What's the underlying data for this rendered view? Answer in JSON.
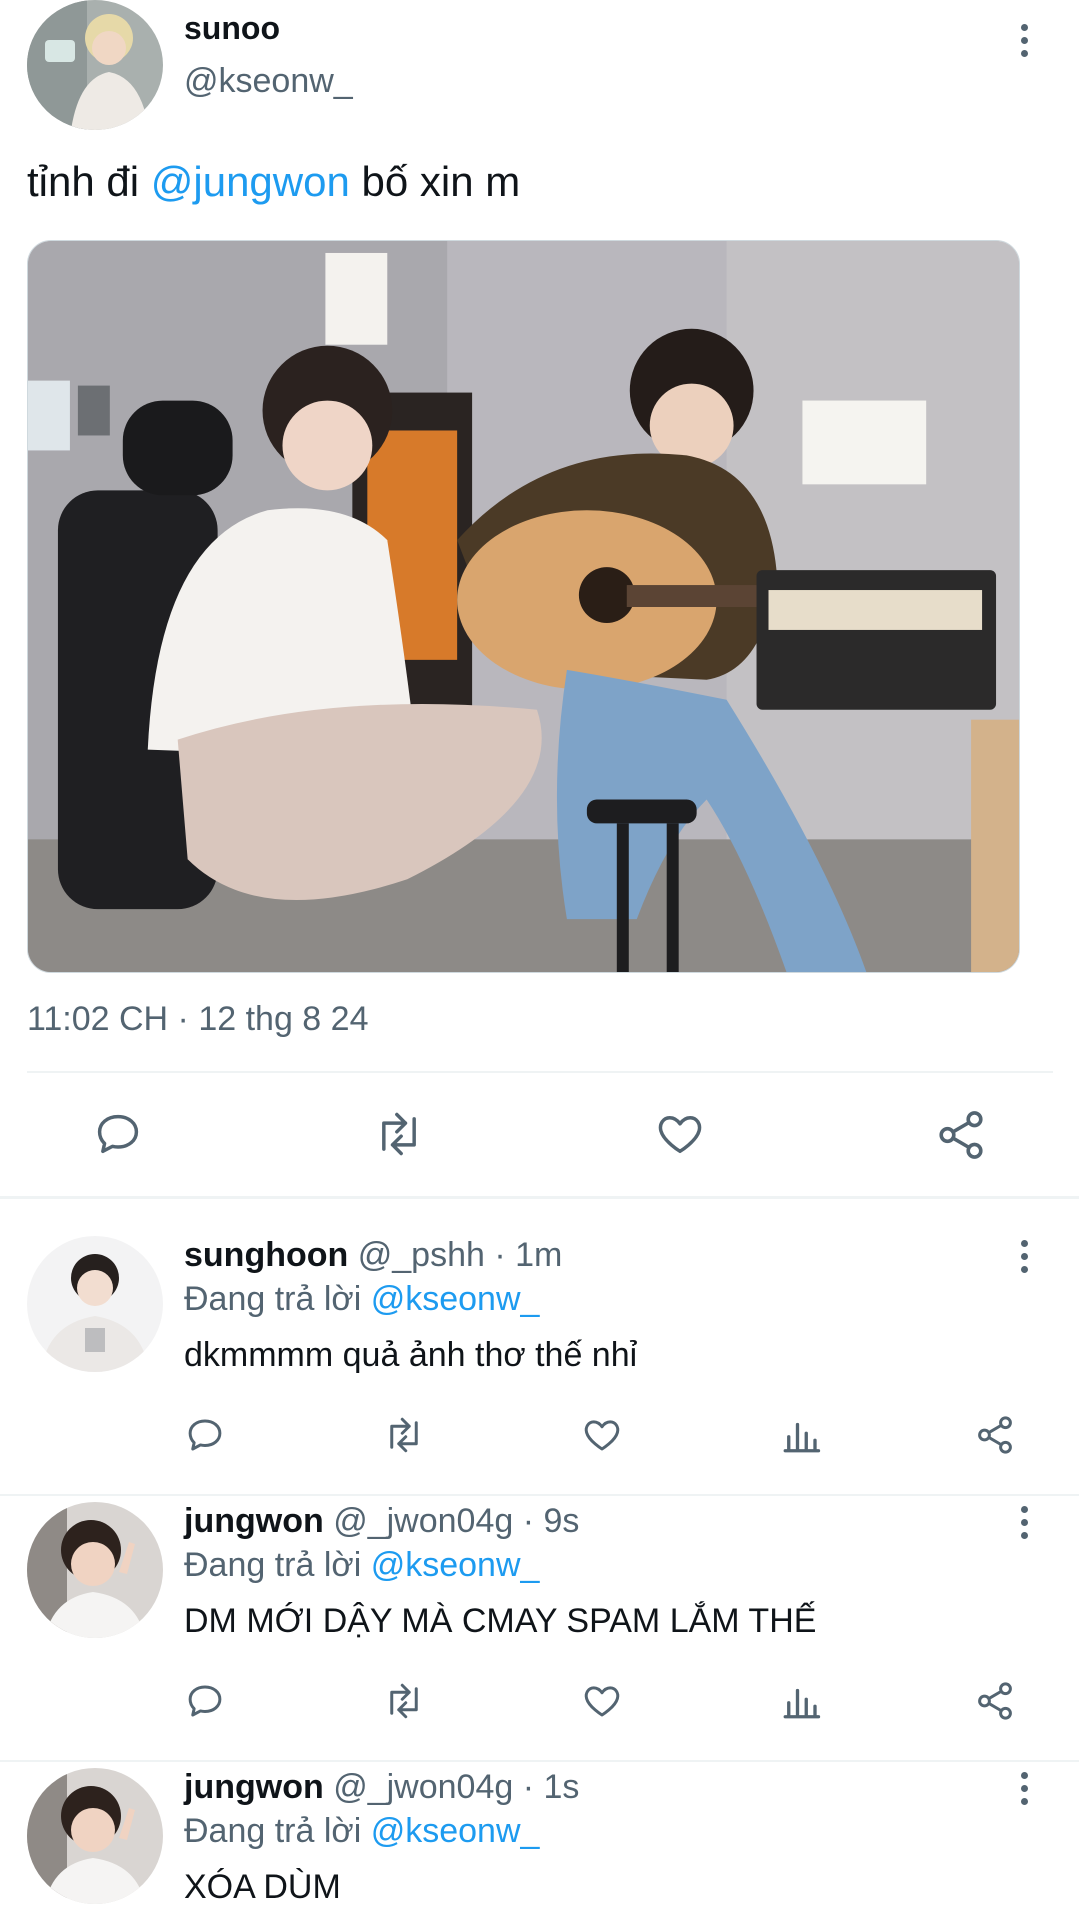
{
  "main_tweet": {
    "display_name": "sunoo",
    "handle": "@kseonw_",
    "text_before": "tỉnh đi ",
    "mention": "@jungwon",
    "text_after": " bố xin m",
    "timestamp": "11:02 CH · 12 thg 8 24",
    "actions": [
      "reply-icon",
      "retweet-icon",
      "like-icon",
      "share-icon"
    ]
  },
  "replies": [
    {
      "display_name": "sunghoon",
      "meta": " @_pshh · 1m",
      "replying_prefix": "Đang trả lời ",
      "replying_to": "@kseonw_",
      "text": "dkmmmm quả ảnh thơ thế nhỉ"
    },
    {
      "display_name": "jungwon",
      "meta": " @_jwon04g · 9s",
      "replying_prefix": "Đang trả lời ",
      "replying_to": "@kseonw_",
      "text": "DM MỚI DẬY MÀ CMAY SPAM LẮM THẾ"
    },
    {
      "display_name": "jungwon",
      "meta": " @_jwon04g · 1s",
      "replying_prefix": "Đang trả lời ",
      "replying_to": "@kseonw_",
      "text": "XÓA DÙM"
    }
  ],
  "colors": {
    "accent": "#1d9bf0",
    "secondary_text": "#536471",
    "primary_text": "#0f1419",
    "divider": "#eff3f4"
  }
}
